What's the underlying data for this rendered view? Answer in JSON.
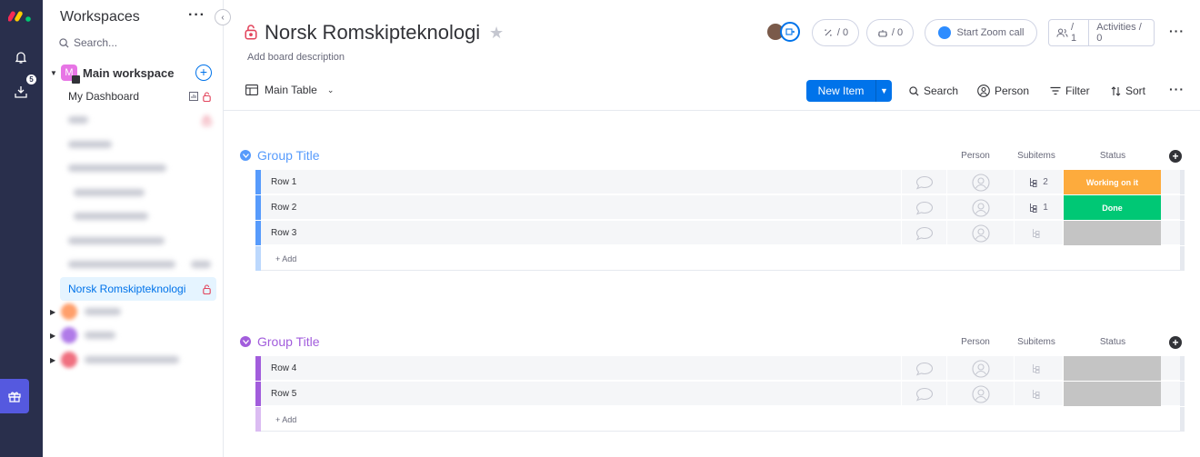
{
  "rail": {
    "logo": "monday-logo",
    "icons": [
      "bell-icon",
      "inbox-icon",
      "gift-icon"
    ],
    "inbox_badge": "5"
  },
  "sidebar": {
    "title": "Workspaces",
    "search_placeholder": "Search...",
    "workspace": {
      "name": "Main workspace",
      "avatar_letter": "M"
    },
    "items": [
      {
        "label": "My Dashboard"
      },
      {
        "label": "Norsk Romskipteknologi",
        "active": true
      }
    ]
  },
  "board": {
    "title": "Norsk Romskipteknologi",
    "description": "Add board description",
    "view": "Main Table",
    "integrations_count": "/ 0",
    "automations_count": "/ 0",
    "zoom_label": "Start Zoom call",
    "members_count": "/ 1",
    "activities_label": "Activities / 0"
  },
  "toolbar": {
    "new_item": "New Item",
    "search": "Search",
    "person": "Person",
    "filter": "Filter",
    "sort": "Sort"
  },
  "columns": {
    "person": "Person",
    "subitems": "Subitems",
    "status": "Status"
  },
  "groups": [
    {
      "title": "Group Title",
      "color": "#579bfc",
      "add_label": "+ Add",
      "rows": [
        {
          "name": "Row 1",
          "subitems": "2",
          "status": "Working on it",
          "status_color": "#fdab3d"
        },
        {
          "name": "Row 2",
          "subitems": "1",
          "status": "Done",
          "status_color": "#00c875"
        },
        {
          "name": "Row 3",
          "subitems": "",
          "status": "",
          "status_color": "#c4c4c4"
        }
      ]
    },
    {
      "title": "Group Title",
      "color": "#a25ddc",
      "add_label": "+ Add",
      "rows": [
        {
          "name": "Row 4",
          "subitems": "",
          "status": "",
          "status_color": "#c4c4c4"
        },
        {
          "name": "Row 5",
          "subitems": "",
          "status": "",
          "status_color": "#c4c4c4"
        }
      ]
    }
  ]
}
